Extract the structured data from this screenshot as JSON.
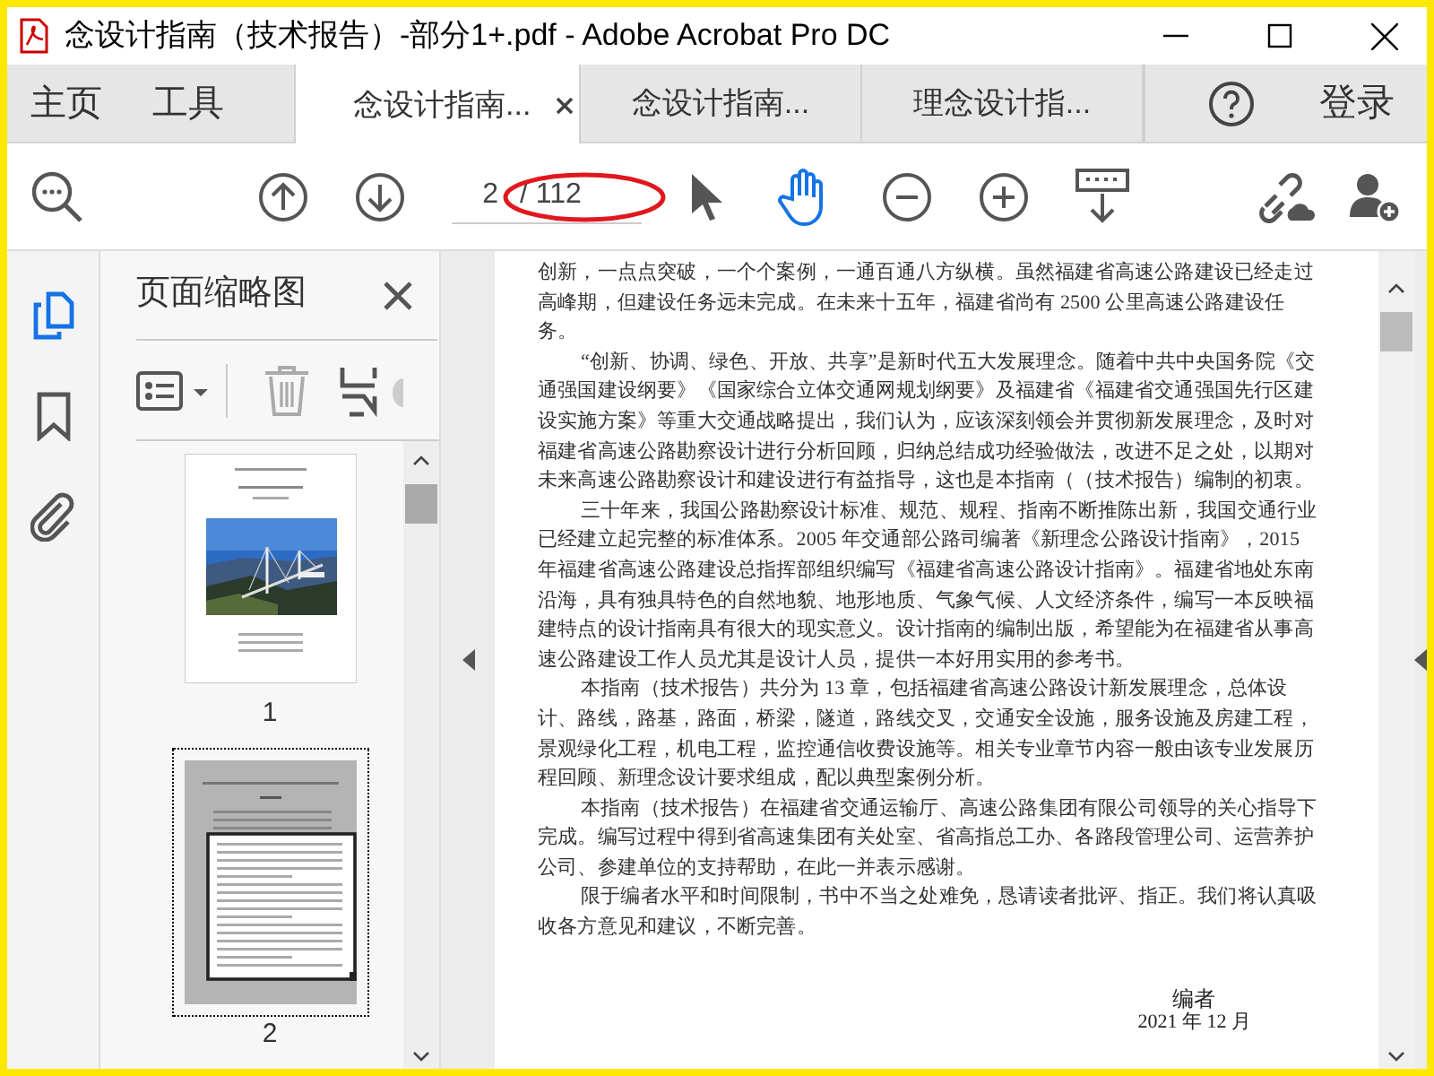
{
  "window": {
    "title": "念设计指南（技术报告）-部分1+.pdf - Adobe Acrobat Pro DC"
  },
  "nav": [
    {
      "label": "主页"
    },
    {
      "label": "工具"
    }
  ],
  "tabs": [
    {
      "label": "念设计指南...",
      "selected": true
    },
    {
      "label": "念设计指南...",
      "selected": false
    },
    {
      "label": "理念设计指...",
      "selected": false
    }
  ],
  "sign_in": "登录",
  "page_field": {
    "value": "2",
    "total": "/ 112"
  },
  "tools": [
    {
      "kind": "select",
      "selected": false
    },
    {
      "kind": "hand",
      "selected": true
    }
  ],
  "rail": [
    {
      "kind": "pages",
      "selected": true
    },
    {
      "kind": "bookmarks",
      "selected": false
    },
    {
      "kind": "attachments",
      "selected": false
    }
  ],
  "panel": {
    "title": "页面缩略图",
    "thumbnails": [
      {
        "label": "1",
        "selected": false
      },
      {
        "label": "2",
        "selected": true
      }
    ]
  },
  "document": {
    "paragraphs": [
      {
        "indent": false,
        "text": "创新，一点点突破，一个个案例，一通百通八方纵横。虽然福建省高速公路建设已经走过高峰期，但建设任务远未完成。在未来十五年，福建省尚有 2500 公里高速公路建设任务。"
      },
      {
        "indent": true,
        "text": "“创新、协调、绿色、开放、共享”是新时代五大发展理念。随着中共中央国务院《交通强国建设纲要》《国家综合立体交通网规划纲要》及福建省《福建省交通强国先行区建设实施方案》等重大交通战略提出，我们认为，应该深刻领会并贯彻新发展理念，及时对福建省高速公路勘察设计进行分析回顾，归纳总结成功经验做法，改进不足之处，以期对未来高速公路勘察设计和建设进行有益指导，这也是本指南（（技术报告）编制的初衷。"
      },
      {
        "indent": true,
        "text": "三十年来，我国公路勘察设计标准、规范、规程、指南不断推陈出新，我国交通行业已经建立起完整的标准体系。2005 年交通部公路司编著《新理念公路设计指南》，2015 年福建省高速公路建设总指挥部组织编写《福建省高速公路设计指南》。福建省地处东南沿海，具有独具特色的自然地貌、地形地质、气象气候、人文经济条件，编写一本反映福建特点的设计指南具有很大的现实意义。设计指南的编制出版，希望能为在福建省从事高速公路建设工作人员尤其是设计人员，提供一本好用实用的参考书。"
      },
      {
        "indent": true,
        "text": "本指南（技术报告）共分为 13 章，包括福建省高速公路设计新发展理念，总体设计、路线，路基，路面，桥梁，隧道，路线交叉，交通安全设施，服务设施及房建工程，景观绿化工程，机电工程，监控通信收费设施等。相关专业章节内容一般由该专业发展历程回顾、新理念设计要求组成，配以典型案例分析。"
      },
      {
        "indent": true,
        "text": "本指南（技术报告）在福建省交通运输厅、高速公路集团有限公司领导的关心指导下完成。编写过程中得到省高速集团有关处室、省高指总工办、各路段管理公司、运营养护公司、参建单位的支持帮助，在此一并表示感谢。"
      },
      {
        "indent": true,
        "text": "限于编者水平和时间限制，书中不当之处难免，恳请读者批评、指正。我们将认真吸收各方意见和建议，不断完善。"
      }
    ],
    "signature": "编者",
    "date": "2021 年 12 月"
  }
}
